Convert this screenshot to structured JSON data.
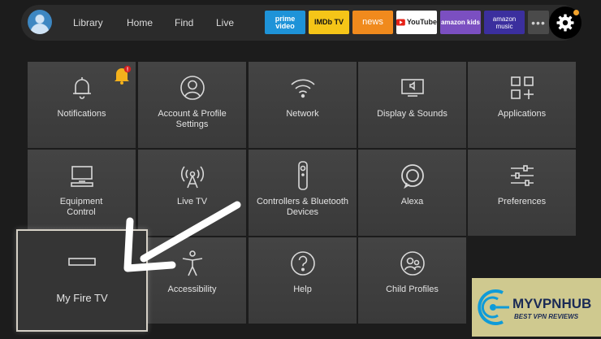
{
  "nav": {
    "links": [
      "Library",
      "Home",
      "Find",
      "Live"
    ],
    "apps": [
      {
        "label": "prime video",
        "bg": "#1e93d8",
        "fg": "#ffffff"
      },
      {
        "label": "IMDb TV",
        "bg": "#f5c518",
        "fg": "#111111"
      },
      {
        "label": "news",
        "bg": "#f08a1d",
        "fg": "#ffffff"
      },
      {
        "label": "YouTube",
        "bg": "#ffffff",
        "fg": "#222222"
      },
      {
        "label": "amazon kids",
        "bg": "#7b4fc1",
        "fg": "#ffffff"
      },
      {
        "label": "amazon music",
        "bg": "#3b2f9e",
        "fg": "#ffffff"
      }
    ],
    "more_label": "•••",
    "accent": "#f2a32c"
  },
  "tiles": [
    {
      "label": "Notifications",
      "icon": "bell-icon"
    },
    {
      "label": "Account & Profile Settings",
      "icon": "user-icon"
    },
    {
      "label": "Network",
      "icon": "wifi-icon"
    },
    {
      "label": "Display & Sounds",
      "icon": "display-sound-icon"
    },
    {
      "label": "Applications",
      "icon": "apps-grid-icon"
    },
    {
      "label": "Equipment Control",
      "icon": "tv-equipment-icon"
    },
    {
      "label": "Live TV",
      "icon": "antenna-icon"
    },
    {
      "label": "Controllers & Bluetooth Devices",
      "icon": "remote-icon"
    },
    {
      "label": "Alexa",
      "icon": "alexa-ring-icon"
    },
    {
      "label": "Preferences",
      "icon": "sliders-icon"
    },
    {
      "label": "My Fire TV",
      "icon": "fire-tv-device-icon"
    },
    {
      "label": "Accessibility",
      "icon": "accessibility-icon"
    },
    {
      "label": "Help",
      "icon": "help-icon"
    },
    {
      "label": "Child Profiles",
      "icon": "child-profiles-icon"
    }
  ],
  "notification_badge": "!",
  "watermark": {
    "word": "MYVPNHUB",
    "tagline": "BEST VPN REVIEWS"
  }
}
